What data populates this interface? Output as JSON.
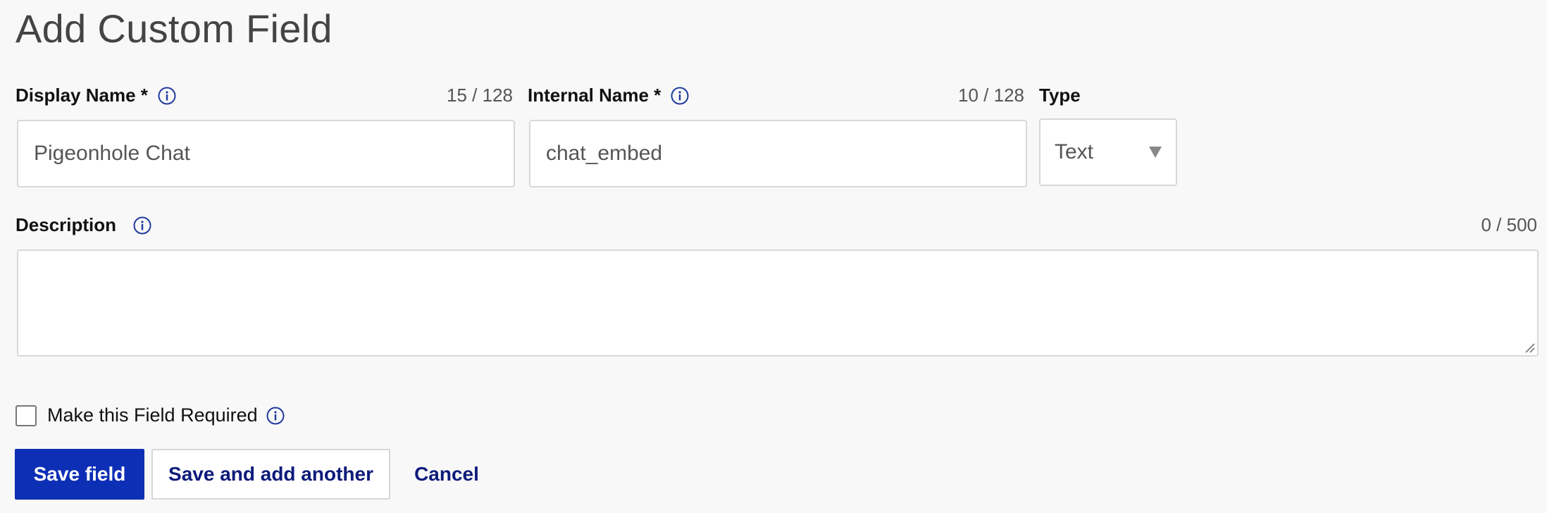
{
  "page": {
    "title": "Add Custom Field"
  },
  "display_name": {
    "label": "Display Name *",
    "counter": "15 / 128",
    "value": "Pigeonhole Chat"
  },
  "internal_name": {
    "label": "Internal Name *",
    "counter": "10 / 128",
    "value": "chat_embed"
  },
  "type": {
    "label": "Type",
    "selected": "Text"
  },
  "description": {
    "label": "Description",
    "counter": "0 / 500",
    "value": ""
  },
  "required": {
    "label": "Make this Field Required",
    "checked": false
  },
  "actions": {
    "save": "Save field",
    "save_another": "Save and add another",
    "cancel": "Cancel"
  },
  "colors": {
    "primary": "#0d2fb5",
    "link": "#0d1a7a",
    "info_icon": "#1f3a9e",
    "page_bg": "#f8f8f8"
  },
  "icons": {
    "info": "info-circle-icon",
    "dropdown": "triangle-down-icon",
    "resize": "resize-grip-icon"
  }
}
